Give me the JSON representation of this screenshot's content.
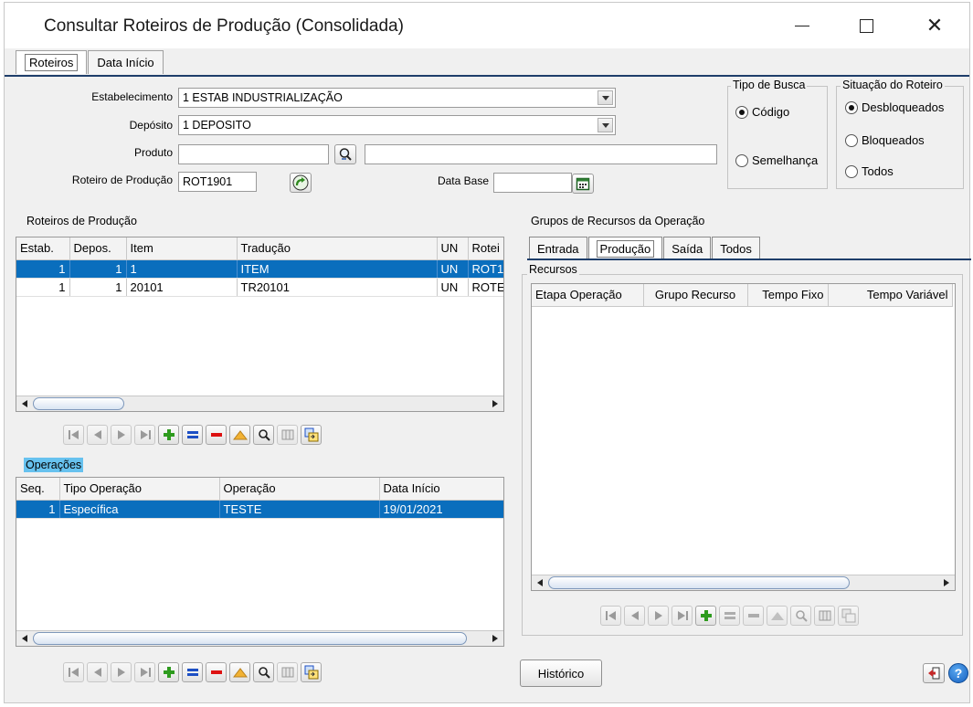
{
  "window": {
    "title": "Consultar Roteiros de Produção (Consolidada)"
  },
  "tabs": [
    "Roteiros",
    "Data Início"
  ],
  "filters": {
    "estabelecimento_label": "Estabelecimento",
    "estabelecimento_value": "1 ESTAB INDUSTRIALIZAÇÃO",
    "deposito_label": "Depósito",
    "deposito_value": "1 DEPOSITO",
    "produto_label": "Produto",
    "produto_code": "",
    "produto_desc": "",
    "roteiro_label": "Roteiro de Produção",
    "roteiro_value": "ROT1901",
    "data_base_label": "Data Base",
    "data_base_value": ""
  },
  "tipo_busca": {
    "title": "Tipo de Busca",
    "options": [
      "Código",
      "Semelhança"
    ],
    "selected": "Código"
  },
  "situacao": {
    "title": "Situação do Roteiro",
    "options": [
      "Desbloqueados",
      "Bloqueados",
      "Todos"
    ],
    "selected": "Desbloqueados"
  },
  "roteiros": {
    "title": "Roteiros de Produção",
    "columns": [
      "Estab.",
      "Depos.",
      "Item",
      "Tradução",
      "UN",
      "Rotei"
    ],
    "rows": [
      [
        "1",
        "1",
        "1",
        "ITEM",
        "UN",
        "ROT1"
      ],
      [
        "1",
        "1",
        "20101",
        "TR20101",
        "UN",
        "ROTE"
      ]
    ]
  },
  "operacoes": {
    "title": "Operações",
    "columns": [
      "Seq.",
      "Tipo Operação",
      "Operação",
      "Data Início"
    ],
    "rows": [
      [
        "1",
        "Específica",
        "TESTE",
        "19/01/2021"
      ]
    ]
  },
  "grupos": {
    "title": "Grupos de Recursos da Operação",
    "tabs": [
      "Entrada",
      "Produção",
      "Saída",
      "Todos"
    ],
    "active_tab": "Produção",
    "recursos_title": "Recursos",
    "columns": [
      "Etapa Operação",
      "Grupo Recurso",
      "Tempo Fixo",
      "Tempo Variável"
    ]
  },
  "buttons": {
    "historico": "Histórico"
  },
  "colors": {
    "selection": "#0a6ebd",
    "tab_line": "#1e3e6a",
    "highlight": "#67c2ef"
  }
}
